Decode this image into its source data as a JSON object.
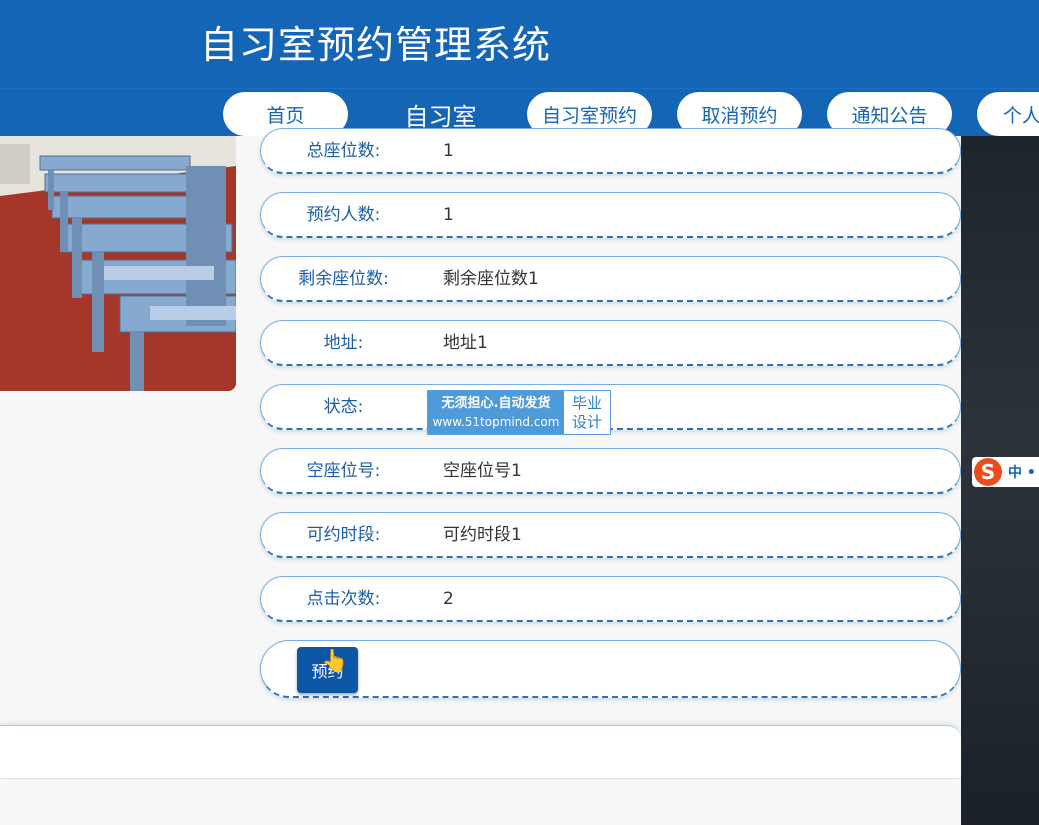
{
  "header": {
    "title": "自习室预约管理系统"
  },
  "nav": {
    "items": [
      {
        "label": "首页"
      },
      {
        "label": "自习室"
      },
      {
        "label": "自习室预约"
      },
      {
        "label": "取消预约"
      },
      {
        "label": "通知公告"
      },
      {
        "label": "个人"
      }
    ]
  },
  "details": [
    {
      "label": "总座位数:",
      "value": "1"
    },
    {
      "label": "预约人数:",
      "value": "1"
    },
    {
      "label": "剩余座位数:",
      "value": "剩余座位数1"
    },
    {
      "label": "地址:",
      "value": "地址1"
    },
    {
      "label": "状态:",
      "value": ""
    },
    {
      "label": "空座位号:",
      "value": "空座位号1"
    },
    {
      "label": "可约时段:",
      "value": "可约时段1"
    },
    {
      "label": "点击次数:",
      "value": "2"
    }
  ],
  "watermark": {
    "line1": "无须担心.自动发货",
    "line2": "www.51topmind.com",
    "right1": "毕业",
    "right2": "设计"
  },
  "action": {
    "reserve_label": "预约"
  },
  "ime": {
    "logo": "S",
    "text": "中 •"
  },
  "colors": {
    "primary": "#1565b6",
    "button": "#0d55a5",
    "label": "#1b5fa8"
  }
}
